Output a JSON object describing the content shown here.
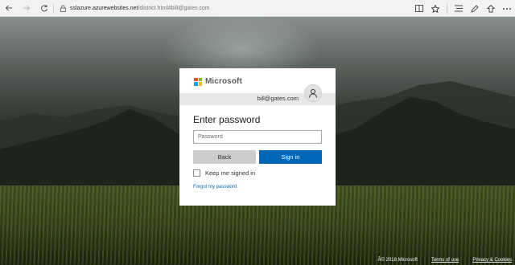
{
  "browser": {
    "url_host": "sslazure.azurewebsites.net",
    "url_path": "/district.html#bill@gates.com",
    "icons": [
      "back-icon",
      "forward-icon",
      "refresh-icon",
      "lock-icon",
      "reading-view-icon",
      "favorite-star-icon",
      "hub-icon",
      "notes-icon",
      "share-icon",
      "more-icon"
    ]
  },
  "dialog": {
    "brand": "Microsoft",
    "logo_colors": [
      "#f25022",
      "#7fba00",
      "#00a4ef",
      "#ffb900"
    ],
    "account_email": "bill@gates.com",
    "title": "Enter password",
    "password_placeholder": "Password",
    "back_label": "Back",
    "signin_label": "Sign in",
    "keep_signed_in_label": "Keep me signed in",
    "forgot_link": "Forgot my password",
    "accent_color": "#0067b8"
  },
  "footer": {
    "copyright": "Â© 2018 Microsoft",
    "terms": "Terms of use",
    "privacy": "Privacy & Cookies"
  }
}
